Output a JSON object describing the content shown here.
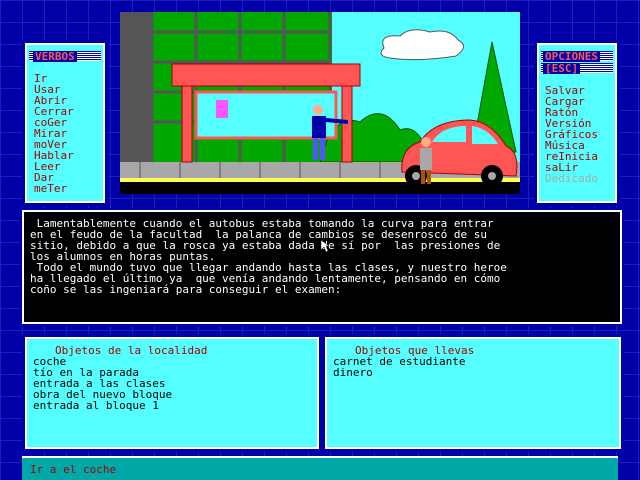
{
  "verbs": {
    "title": "VERBOS",
    "items": [
      {
        "label": "Ir"
      },
      {
        "label": "Usar"
      },
      {
        "label": "Abrir"
      },
      {
        "label": "Cerrar"
      },
      {
        "label": "coGer"
      },
      {
        "label": "Mirar"
      },
      {
        "label": "moVer"
      },
      {
        "label": "Hablar"
      },
      {
        "label": "Leer"
      },
      {
        "label": "Dar"
      },
      {
        "label": "meTer"
      }
    ]
  },
  "options": {
    "title": "OPCIONES",
    "esc": "[ESC]",
    "items": [
      {
        "label": "Salvar"
      },
      {
        "label": "Cargar"
      },
      {
        "label": "Ratón"
      },
      {
        "label": "Versión"
      },
      {
        "label": "Gráficos"
      },
      {
        "label": "Música"
      },
      {
        "label": "reInicia"
      },
      {
        "label": "saLir"
      },
      {
        "label": "Dedicado"
      }
    ]
  },
  "narration": {
    "lines": [
      " Lamentablemente cuando el autobus estaba tomando la curva para entrar",
      "en el feudo de la facultad  la palanca de cambios se desenroscó de su",
      "sitio, debido a que la rosca ya estaba dada de sí por  las presiones de",
      "los alumnos en horas puntas.",
      " Todo el mundo tuvo que llegar andando hasta las clases, y nuestro heroe",
      "ha llegado el último ya  que venía andando lentamente, pensando en cómo",
      "coño se las ingeniará para conseguir el examen:"
    ]
  },
  "location_objects": {
    "title": "Objetos de la localidad",
    "items": [
      "coche",
      "tío en la parada",
      "entrada a las clases",
      "obra del nuevo bloque",
      "entrada al bloque 1"
    ]
  },
  "carried_objects": {
    "title": "Objetos que llevas",
    "items": [
      "carnet de estudiante",
      "dinero"
    ]
  },
  "command": {
    "text": "Ir a el coche"
  },
  "colors": {
    "background": "#0000a8",
    "panel": "#55ffff",
    "text_red": "#a80000",
    "car": "#ff5555"
  }
}
